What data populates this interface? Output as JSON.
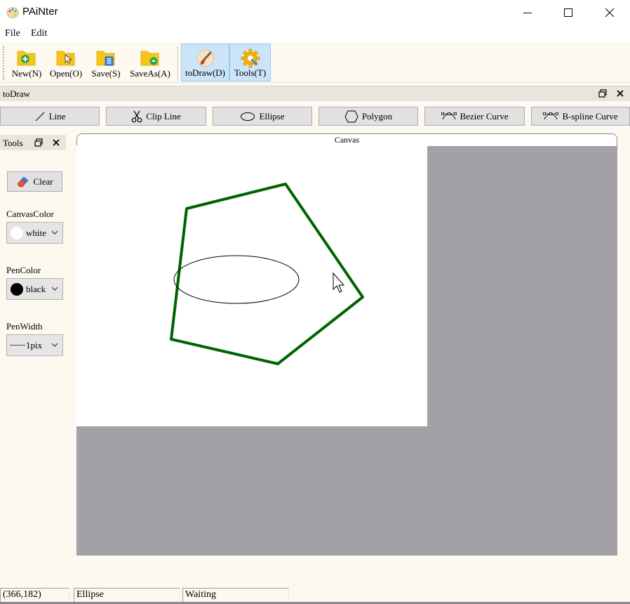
{
  "window": {
    "title": "PAiNter"
  },
  "menu": {
    "file": "File",
    "edit": "Edit"
  },
  "toolbar": {
    "new_label": "New(N)",
    "open_label": "Open(O)",
    "save_label": "Save(S)",
    "saveas_label": "SaveAs(A)",
    "todraw_label": "toDraw(D)",
    "tools_label": "Tools(T)"
  },
  "dock": {
    "title": "toDraw"
  },
  "shapes": {
    "line": "Line",
    "clip_line": "Clip Line",
    "ellipse": "Ellipse",
    "polygon": "Polygon",
    "bezier": "Bezier Curve",
    "bspline": "B-spline Curve"
  },
  "tools": {
    "title": "Tools",
    "clear_label": "Clear",
    "canvas_color_label": "CanvasColor",
    "canvas_color_value": "white",
    "pen_color_label": "PenColor",
    "pen_color_value": "black",
    "pen_width_label": "PenWidth",
    "pen_width_value": "1pix"
  },
  "canvas": {
    "tab_label": "Canvas",
    "background_color": "#ffffff",
    "outside_color": "#a2a1a6",
    "polygon_color": "#006400",
    "ellipse_color": "#000000"
  },
  "status": {
    "coords": "(366,182)",
    "tool": "Ellipse",
    "state": "Waiting"
  },
  "colors": {
    "toolbar_active": "#cce4f7",
    "accent_folder": "#f5c518"
  }
}
